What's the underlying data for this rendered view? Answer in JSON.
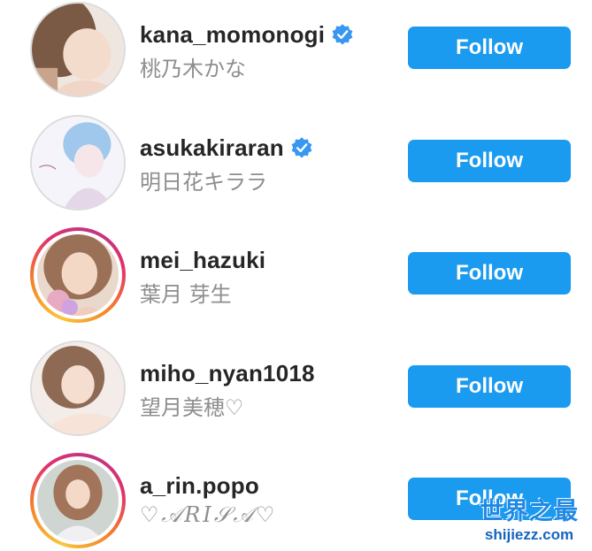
{
  "accounts": [
    {
      "username": "kana_momonogi",
      "full_name": "桃乃木かな",
      "verified": true,
      "story_ring": false,
      "follow_label": "Follow"
    },
    {
      "username": "asukakiraran",
      "full_name": "明日花キララ",
      "verified": true,
      "story_ring": false,
      "follow_label": "Follow"
    },
    {
      "username": "mei_hazuki",
      "full_name": "葉月 芽生",
      "verified": false,
      "story_ring": true,
      "follow_label": "Follow"
    },
    {
      "username": "miho_nyan1018",
      "full_name": "望月美穂♡",
      "verified": false,
      "story_ring": false,
      "follow_label": "Follow"
    },
    {
      "username": "a_rin.popo",
      "full_name": "♡𝒜𝑅𝐼𝒮𝒜♡",
      "verified": false,
      "story_ring": true,
      "follow_label": "Follow"
    }
  ],
  "icons": {
    "verified": "verified-badge-icon",
    "avatar": "profile-photo"
  },
  "colors": {
    "follow_button": "#1a9bf0",
    "verified_badge": "#3897f0",
    "username": "#262626",
    "full_name": "#8e8e8e"
  },
  "watermark": {
    "title": "世界之最",
    "url": "shijiezz.com"
  }
}
